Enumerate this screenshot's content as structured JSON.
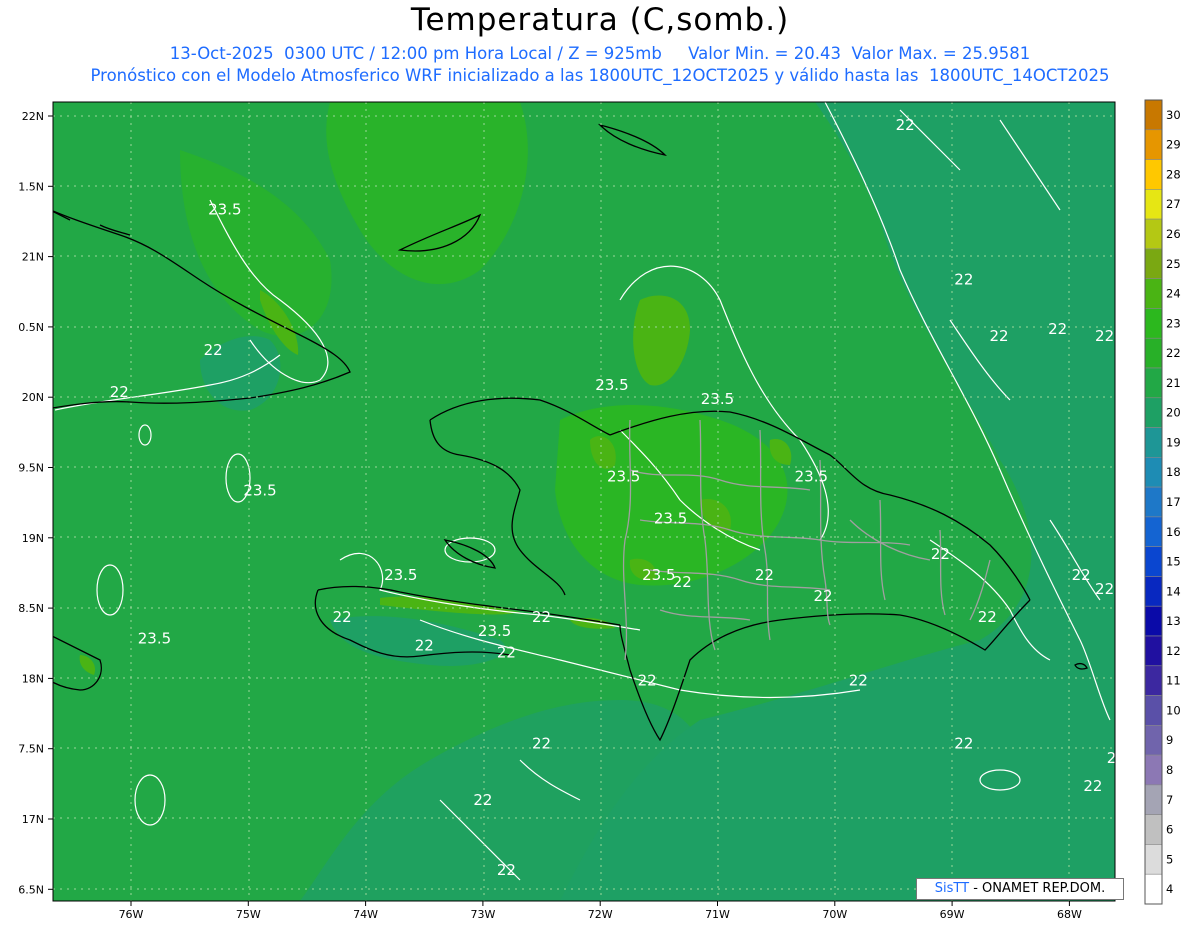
{
  "header": {
    "title": "Temperatura (C,somb.)",
    "subtitle_1": "13-Oct-2025  0300 UTC / 12:00 pm Hora Local / Z = 925mb     Valor Min. = 20.43  Valor Max. = 25.9581",
    "subtitle_2": "Pronóstico con el Modelo Atmosferico WRF inicializado a las 1800UTC_12OCT2025 y válido hasta las  1800UTC_14OCT2025"
  },
  "map": {
    "lon_ticks": [
      "76W",
      "75W",
      "74W",
      "73W",
      "72W",
      "71W",
      "70W",
      "69W",
      "68W"
    ],
    "lat_ticks": [
      "22N",
      "1.5N",
      "21N",
      "0.5N",
      "20N",
      "9.5N",
      "19N",
      "8.5N",
      "18N",
      "7.5N",
      "17N",
      "6.5N"
    ],
    "contour_labels": [
      {
        "text": "23.5",
        "lon": -75.2,
        "lat": 21.3
      },
      {
        "text": "22",
        "lon": -75.3,
        "lat": 20.3
      },
      {
        "text": "22",
        "lon": -76.1,
        "lat": 20.0
      },
      {
        "text": "23.5",
        "lon": -74.9,
        "lat": 19.3
      },
      {
        "text": "23.5",
        "lon": -73.7,
        "lat": 18.7
      },
      {
        "text": "22",
        "lon": -74.2,
        "lat": 18.4
      },
      {
        "text": "23.5",
        "lon": -72.9,
        "lat": 18.3
      },
      {
        "text": "22",
        "lon": -72.5,
        "lat": 18.4
      },
      {
        "text": "22",
        "lon": -73.5,
        "lat": 18.2
      },
      {
        "text": "22",
        "lon": -72.8,
        "lat": 18.15
      },
      {
        "text": "23.5",
        "lon": -75.8,
        "lat": 18.25
      },
      {
        "text": "23.5",
        "lon": -71.9,
        "lat": 20.05
      },
      {
        "text": "23.5",
        "lon": -71.0,
        "lat": 19.95
      },
      {
        "text": "23.5",
        "lon": -71.8,
        "lat": 19.4
      },
      {
        "text": "23.5",
        "lon": -71.4,
        "lat": 19.1
      },
      {
        "text": "23.5",
        "lon": -70.2,
        "lat": 19.4
      },
      {
        "text": "23.5",
        "lon": -71.5,
        "lat": 18.7
      },
      {
        "text": "22",
        "lon": -71.3,
        "lat": 18.65
      },
      {
        "text": "22",
        "lon": -70.6,
        "lat": 18.7
      },
      {
        "text": "22",
        "lon": -70.1,
        "lat": 18.55
      },
      {
        "text": "22",
        "lon": -69.1,
        "lat": 18.85
      },
      {
        "text": "22",
        "lon": -68.7,
        "lat": 18.4
      },
      {
        "text": "22",
        "lon": -67.9,
        "lat": 18.7
      },
      {
        "text": "22",
        "lon": -67.7,
        "lat": 18.6
      },
      {
        "text": "22",
        "lon": -71.6,
        "lat": 17.95
      },
      {
        "text": "22",
        "lon": -69.8,
        "lat": 17.95
      },
      {
        "text": "22",
        "lon": -68.6,
        "lat": 20.4
      },
      {
        "text": "22",
        "lon": -68.9,
        "lat": 20.8
      },
      {
        "text": "22",
        "lon": -68.1,
        "lat": 20.45
      },
      {
        "text": "22",
        "lon": -67.7,
        "lat": 20.4
      },
      {
        "text": "22",
        "lon": -67.5,
        "lat": 21.4
      },
      {
        "text": "22",
        "lon": -69.4,
        "lat": 21.9
      },
      {
        "text": "22",
        "lon": -72.5,
        "lat": 17.5
      },
      {
        "text": "22",
        "lon": -68.9,
        "lat": 17.5
      },
      {
        "text": "22",
        "lon": -67.8,
        "lat": 17.2
      },
      {
        "text": "22",
        "lon": -67.6,
        "lat": 17.4
      },
      {
        "text": "22",
        "lon": -73.0,
        "lat": 17.1
      },
      {
        "text": "22",
        "lon": -72.8,
        "lat": 16.6
      }
    ]
  },
  "colorbar": {
    "levels": [
      "4",
      "5",
      "6",
      "7",
      "8",
      "9",
      "10",
      "11",
      "12",
      "13",
      "14",
      "15",
      "16",
      "17",
      "18",
      "19",
      "20",
      "21",
      "22",
      "23",
      "24",
      "25",
      "26",
      "27",
      "28",
      "29",
      "30"
    ],
    "colors": [
      "#ffffff",
      "#dcdcdc",
      "#c0c0c0",
      "#a4a4b4",
      "#8c78b4",
      "#7064ac",
      "#5a50a8",
      "#3c28a0",
      "#2010a0",
      "#0a0aa8",
      "#0828c0",
      "#0a46d0",
      "#1464d2",
      "#1e78c8",
      "#1e8cb4",
      "#1e9696",
      "#1ea064",
      "#22a846",
      "#28b028",
      "#2cb81e",
      "#4ab414",
      "#7aa812",
      "#b4c814",
      "#e6e614",
      "#ffc800",
      "#e69600",
      "#c87800"
    ]
  },
  "credit": {
    "part1": "SisTT",
    "part2": "- ONAMET REP.DOM."
  }
}
